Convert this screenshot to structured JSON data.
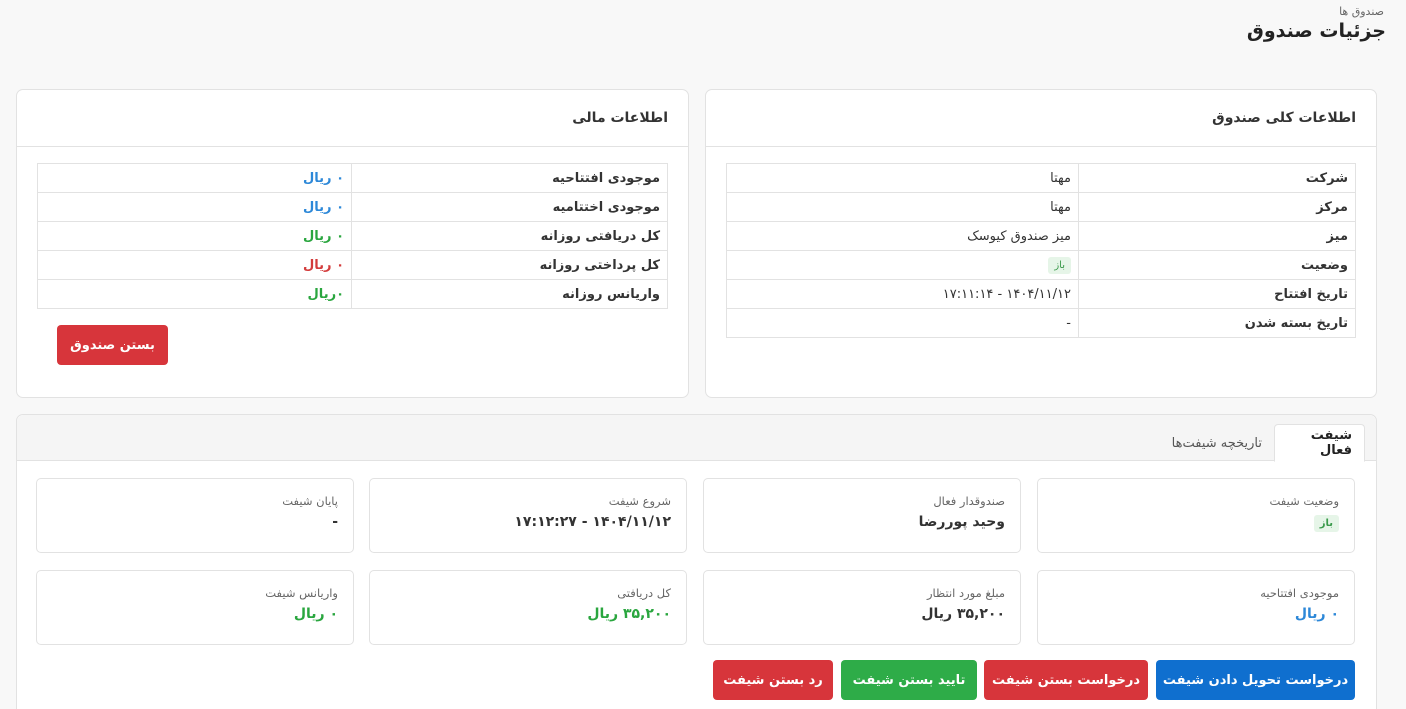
{
  "header": {
    "breadcrumb": "صندوق ها",
    "title": "جزئیات صندوق"
  },
  "general": {
    "title": "اطلاعات کلی صندوق",
    "rows": [
      {
        "label": "شرکت",
        "value": "مهتا"
      },
      {
        "label": "مرکز",
        "value": "مهتا"
      },
      {
        "label": "میز",
        "value": "میز صندوق کیوسک"
      },
      {
        "label": "وضعیت",
        "value": "باز"
      },
      {
        "label": "تاریخ افتتاح",
        "value": "۱۴۰۴/۱۱/۱۲ - ۱۷:۱۱:۱۴"
      },
      {
        "label": "تاریخ بسته شدن",
        "value": "-"
      }
    ]
  },
  "financial": {
    "title": "اطلاعات مالی",
    "rows": [
      {
        "label": "موجودی افتتاحیه",
        "value": "۰ ریال",
        "color": "#2d88d8"
      },
      {
        "label": "موجودی اختتامیه",
        "value": "۰ ریال",
        "color": "#2d88d8"
      },
      {
        "label": "کل دریافتی روزانه",
        "value": "۰ ریال",
        "color": "#2aa63f"
      },
      {
        "label": "کل پرداختی روزانه",
        "value": "۰ ریال",
        "color": "#d33c3c"
      },
      {
        "label": "واریانس روزانه",
        "value": "۰ریال",
        "color": "#2aa63f"
      }
    ],
    "close_button": "بستن صندوق"
  },
  "tabs": [
    {
      "label": "شیفت فعال",
      "active": true
    },
    {
      "label": "تاریخچه شیفت‌ها",
      "active": false
    }
  ],
  "shift": {
    "status": {
      "label": "وضعیت شیفت",
      "value": "باز"
    },
    "cashier": {
      "label": "صندوقدار فعال",
      "value": "وحید پوررضا"
    },
    "start": {
      "label": "شروع شیفت",
      "value": "۱۴۰۴/۱۱/۱۲ - ۱۷:۱۲:۲۷"
    },
    "end": {
      "label": "پایان شیفت",
      "value": "-"
    },
    "opening": {
      "label": "موجودی افتتاحیه",
      "value": "۰ ریال"
    },
    "expected": {
      "label": "مبلغ مورد انتظار",
      "value": "۳۵,۲۰۰ ریال"
    },
    "received": {
      "label": "کل دریافتی",
      "value": "۳۵,۲۰۰ ریال"
    },
    "variance": {
      "label": "واریانس شیفت",
      "value": "۰ ریال"
    }
  },
  "actions": {
    "handover": "درخواست تحویل دادن شیفت",
    "request_close": "درخواست بستن شیفت",
    "approve_close": "تایید بستن شیفت",
    "reject_close": "رد بستن شیفت"
  },
  "colors": {
    "primary": "#0f6fcf",
    "danger": "#d7353b",
    "success": "#2eac48",
    "info": "#2d88d8"
  }
}
